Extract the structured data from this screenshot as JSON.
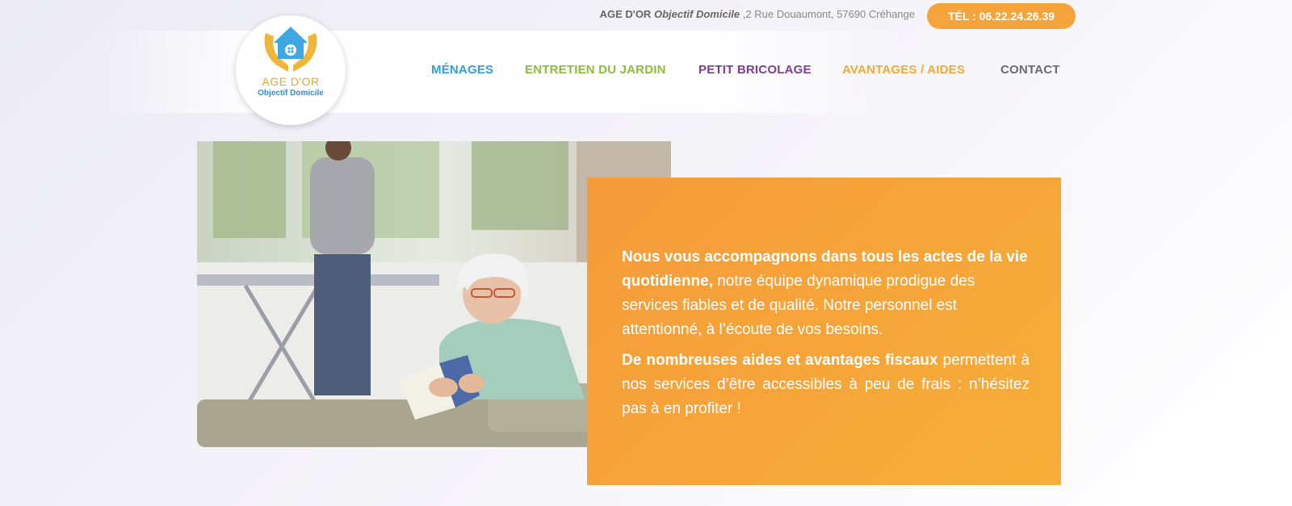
{
  "topbar": {
    "brand": "AGE D'OR",
    "brand_italic": "Objectif Domicile",
    "address": ",2 Rue Douaumont, 57690 Créhange",
    "phone_label": "TÉL : 06.22.24.26.39"
  },
  "logo": {
    "name": "AGE D'OR",
    "subtitle": "Objectif Domicile"
  },
  "nav": {
    "items": [
      {
        "label": "MÉNAGES",
        "color": "#2f9fdd"
      },
      {
        "label": "ENTRETIEN DU JARDIN",
        "color": "#8cbd3b"
      },
      {
        "label": "PETIT BRICOLAGE",
        "color": "#7c3e93"
      },
      {
        "label": "AVANTAGES / AIDES",
        "color": "#f3aa35"
      },
      {
        "label": "CONTACT",
        "color": "#6b6b6b"
      }
    ]
  },
  "intro": {
    "p1_bold": "Nous vous accompagnons dans tous les actes de la vie quotidienne,",
    "p1_rest": " notre équipe dynamique prodigue des services fiables et de qualité. Notre personnel est attentionné, à l’écoute de vos besoins.",
    "p2_bold": "De nombreuses aides et avantages fiscaux",
    "p2_rest": " permettent à nos services d’être accessibles à peu de frais : n’hésitez pas à en profiter !"
  },
  "colors": {
    "accent_orange": "#f5a43b",
    "blue": "#2f9fdd",
    "green": "#8cbd3b",
    "purple": "#7c3e93"
  }
}
